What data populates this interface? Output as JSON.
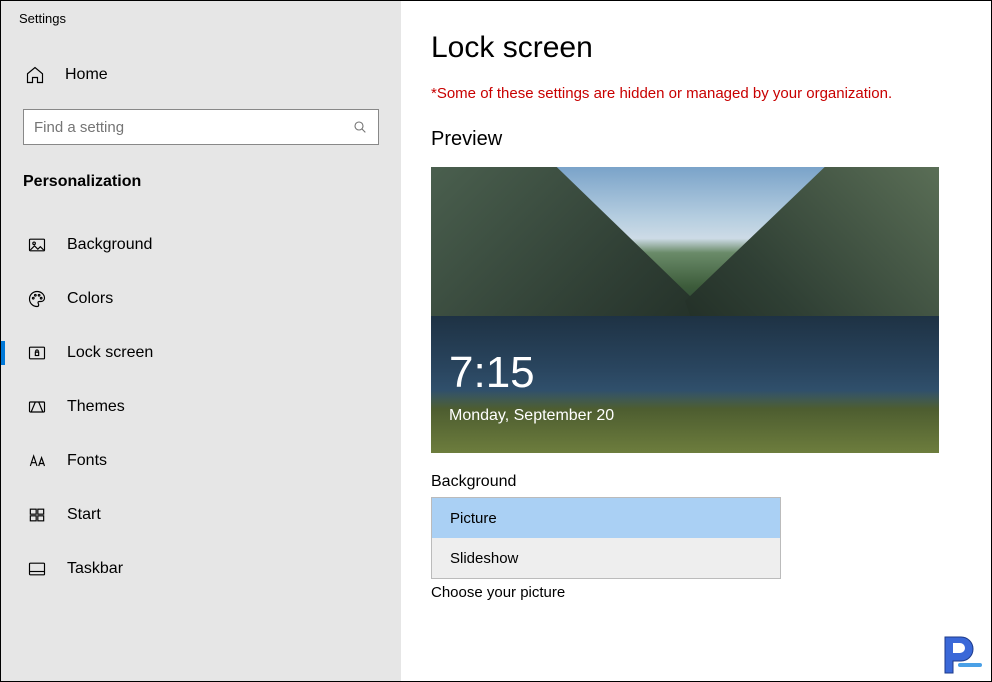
{
  "window_title": "Settings",
  "home_label": "Home",
  "search": {
    "placeholder": "Find a setting"
  },
  "category": "Personalization",
  "nav": {
    "items": [
      {
        "label": "Background"
      },
      {
        "label": "Colors"
      },
      {
        "label": "Lock screen"
      },
      {
        "label": "Themes"
      },
      {
        "label": "Fonts"
      },
      {
        "label": "Start"
      },
      {
        "label": "Taskbar"
      }
    ]
  },
  "page": {
    "title": "Lock screen",
    "warning": "*Some of these settings are hidden or managed by your organization.",
    "preview_heading": "Preview",
    "preview_time": "7:15",
    "preview_date": "Monday, September 20",
    "bg_field_label": "Background",
    "bg_options": {
      "picture": "Picture",
      "slideshow": "Slideshow"
    },
    "choose_picture_label": "Choose your picture"
  }
}
